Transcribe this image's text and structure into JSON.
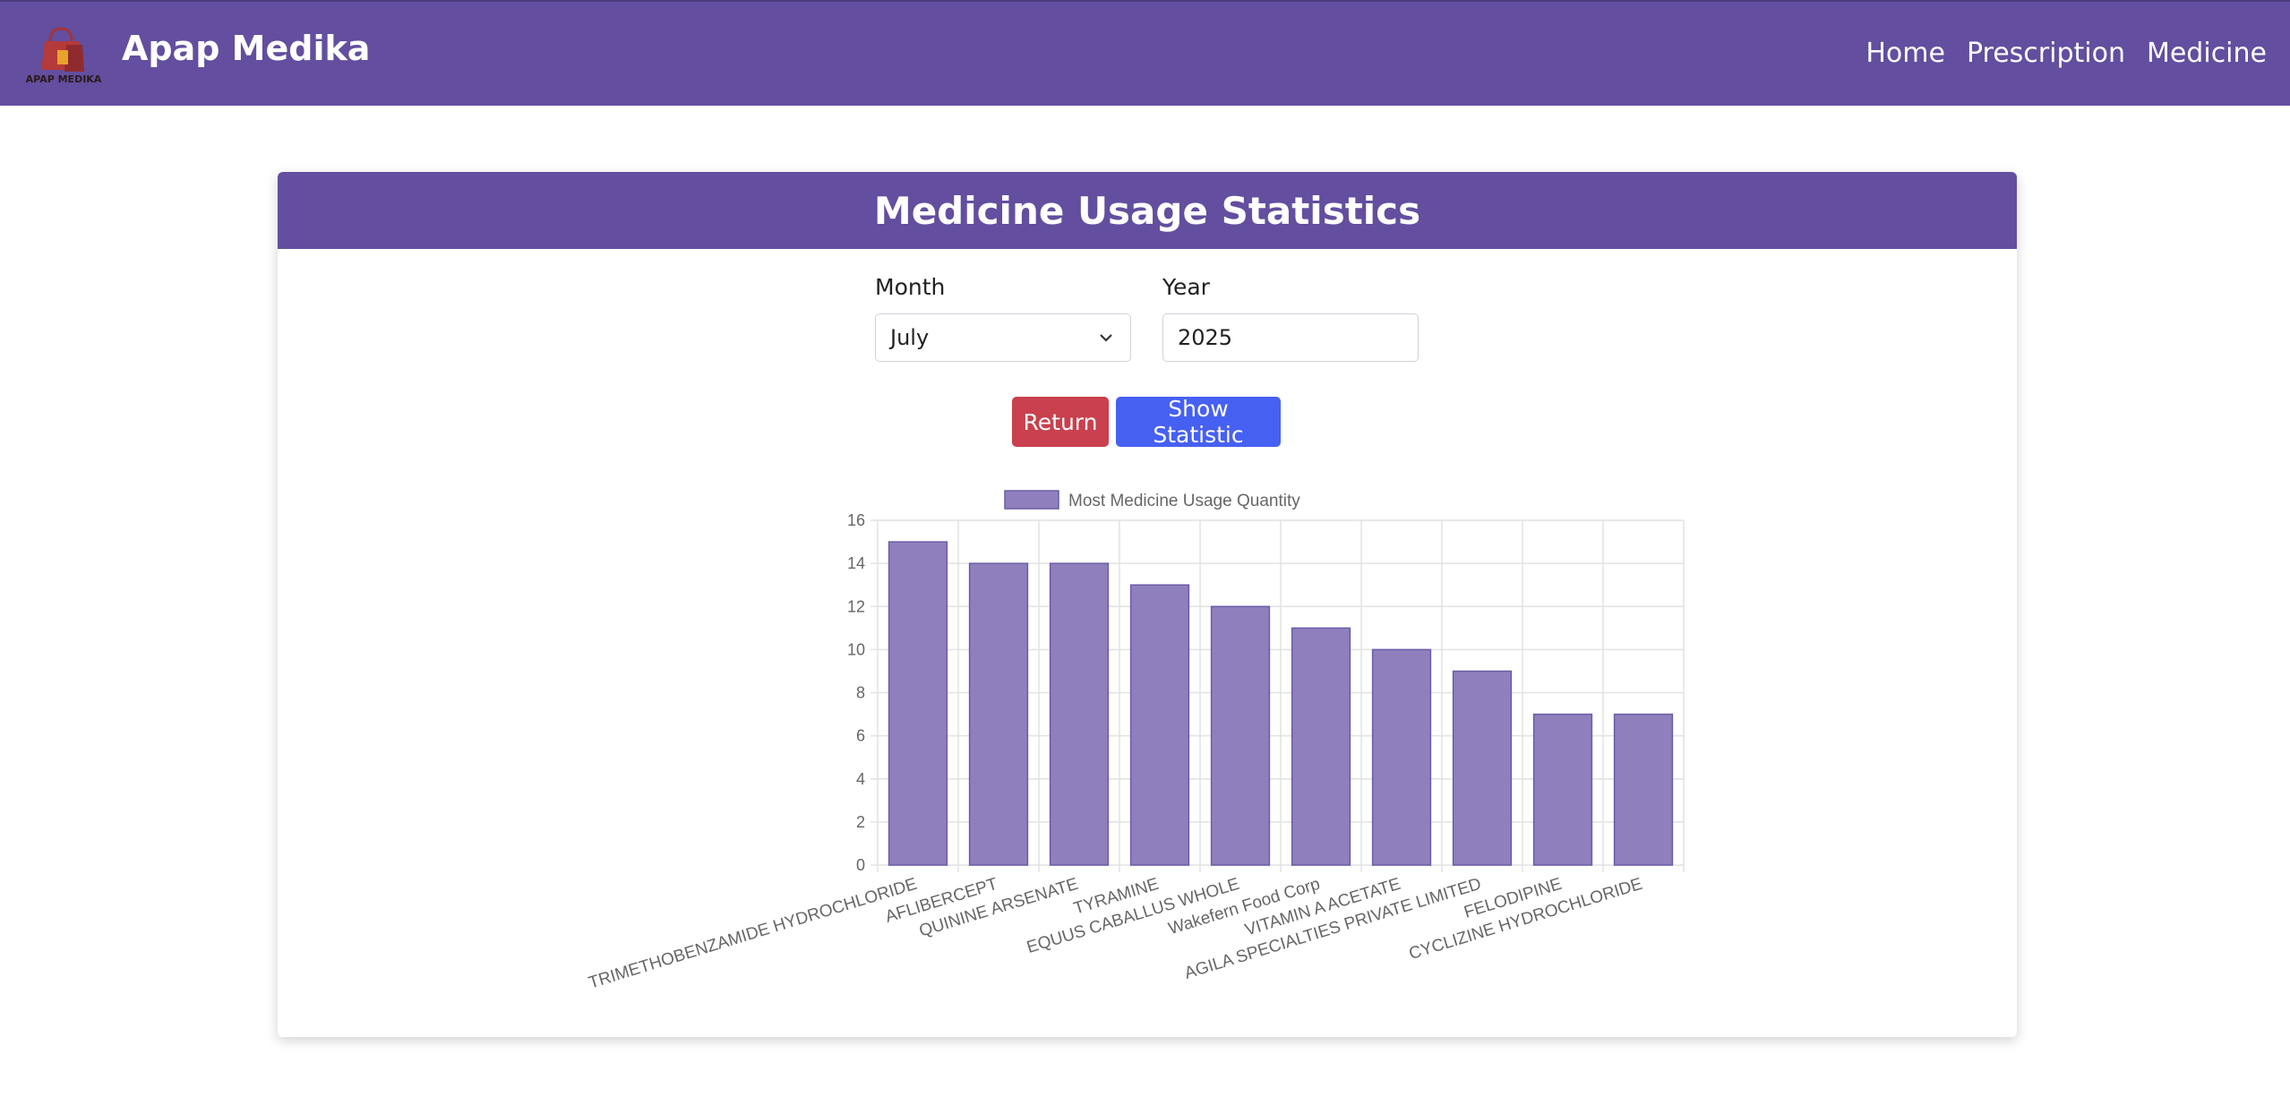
{
  "navbar": {
    "brand": "Apap Medika",
    "logo_text": "APAP MEDIKA",
    "links": [
      {
        "label": "Home"
      },
      {
        "label": "Prescription"
      },
      {
        "label": "Medicine"
      }
    ],
    "color": "#634e9f"
  },
  "card": {
    "title": "Medicine Usage Statistics"
  },
  "filters": {
    "month_label": "Month",
    "month_value": "July",
    "year_label": "Year",
    "year_value": "2025"
  },
  "buttons": {
    "return_label": "Return",
    "show_label": "Show Statistic",
    "return_color": "#c9404e",
    "show_color": "#4660f2"
  },
  "chart_data": {
    "type": "bar",
    "categories": [
      "TRIMETHOBENZAMIDE HYDROCHLORIDE",
      "AFLIBERCEPT",
      "QUININE ARSENATE",
      "TYRAMINE",
      "EQUUS CABALLUS WHOLE",
      "Wakefern Food Corp",
      "VITAMIN A ACETATE",
      "AGILA SPECIALTIES PRIVATE LIMITED",
      "FELODIPINE",
      "CYCLIZINE HYDROCHLORIDE"
    ],
    "series": [
      {
        "name": "Most Medicine Usage Quantity",
        "values": [
          15,
          14,
          14,
          13,
          12,
          11,
          10,
          9,
          7,
          7
        ]
      }
    ],
    "ylim": [
      0,
      16
    ],
    "yticks": [
      0,
      2,
      4,
      6,
      8,
      10,
      12,
      14,
      16
    ],
    "grid": true,
    "legend_position": "top",
    "bar_color": "#8f80bd",
    "bar_border": "#6b5ba8"
  }
}
